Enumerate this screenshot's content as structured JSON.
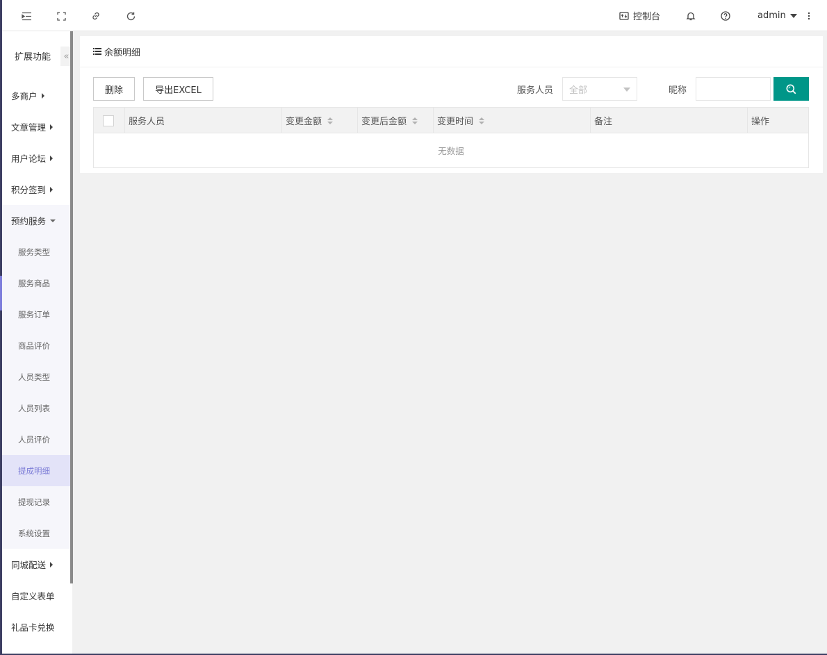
{
  "topbar": {
    "console_label": "控制台",
    "username": "admin"
  },
  "sidebar": {
    "title": "扩展功能",
    "collapse_glyph": "«",
    "menu": [
      {
        "label": "多商户"
      },
      {
        "label": "文章管理"
      },
      {
        "label": "用户论坛"
      },
      {
        "label": "积分签到"
      },
      {
        "label": "预约服务"
      }
    ],
    "submenu": [
      {
        "label": "服务类型"
      },
      {
        "label": "服务商品"
      },
      {
        "label": "服务订单"
      },
      {
        "label": "商品评价"
      },
      {
        "label": "人员类型"
      },
      {
        "label": "人员列表"
      },
      {
        "label": "人员评价"
      },
      {
        "label": "提成明细"
      },
      {
        "label": "提现记录"
      },
      {
        "label": "系统设置"
      }
    ],
    "menu_after": [
      {
        "label": "同城配送"
      },
      {
        "label": "自定义表单"
      },
      {
        "label": "礼品卡兑换"
      }
    ]
  },
  "content": {
    "title": "余额明细",
    "delete_button": "删除",
    "export_button": "导出EXCEL",
    "filter_staff_label": "服务人员",
    "filter_staff_value": "全部",
    "filter_nickname_label": "昵称",
    "filter_nickname_value": "",
    "table": {
      "columns": [
        "服务人员",
        "变更金额",
        "变更后金额",
        "变更时间",
        "备注",
        "操作"
      ],
      "empty_text": "无数据"
    }
  },
  "colors": {
    "accent": "#009688",
    "sidebar_active_bg": "#e3e3f8",
    "sidebar_active_text": "#7b7bd6",
    "dark_strip": "#3d3f63"
  }
}
